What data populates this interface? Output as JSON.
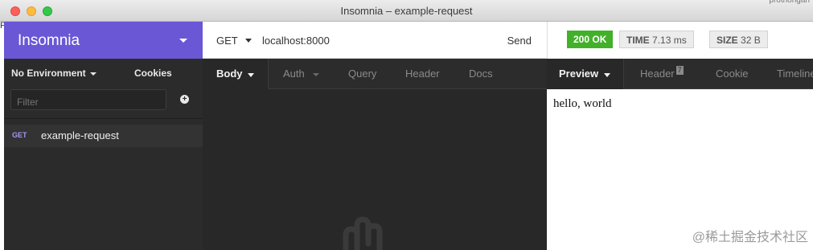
{
  "window": {
    "title": "Insomnia – example-request",
    "background_app_text": "protnongan",
    "left_edge_glyph": "P"
  },
  "sidebar": {
    "workspace_title": "Insomnia",
    "environment_label": "No Environment",
    "cookies_label": "Cookies",
    "filter_placeholder": "Filter",
    "add_icon": "plus-circle-icon",
    "requests": [
      {
        "method": "GET",
        "name": "example-request"
      }
    ]
  },
  "request": {
    "method": "GET",
    "url": "localhost:8000",
    "send_label": "Send",
    "tabs": [
      "Body",
      "Auth",
      "Query",
      "Header",
      "Docs"
    ],
    "active_tab": "Body"
  },
  "response": {
    "status": "200 OK",
    "time_label": "TIME",
    "time_value": "7.13 ms",
    "size_label": "SIZE",
    "size_value": "32 B",
    "tabs": [
      "Preview",
      "Header",
      "Cookie",
      "Timeline"
    ],
    "header_count": "7",
    "active_tab": "Preview",
    "body_text": "hello, world"
  },
  "watermark": "@稀土掘金技术社区",
  "colors": {
    "brand": "#6a57d5",
    "status_ok": "#43b02a",
    "get_method": "#a695f2"
  }
}
